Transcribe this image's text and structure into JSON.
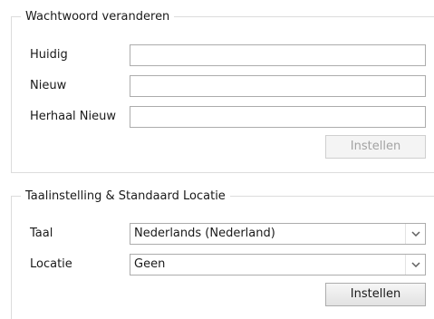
{
  "password_section": {
    "title": "Wachtwoord veranderen",
    "fields": [
      {
        "label": "Huidig",
        "value": ""
      },
      {
        "label": "Nieuw",
        "value": ""
      },
      {
        "label": "Herhaal Nieuw",
        "value": ""
      }
    ],
    "submit_label": "Instellen",
    "submit_enabled": false
  },
  "language_section": {
    "title": "Taalinstelling & Standaard Locatie",
    "language": {
      "label": "Taal",
      "selected": "Nederlands (Nederland)"
    },
    "location": {
      "label": "Locatie",
      "selected": "Geen"
    },
    "submit_label": "Instellen",
    "submit_enabled": true
  },
  "icons": {
    "dropdown": "chevron-down-icon"
  },
  "colors": {
    "border": "#acacac",
    "disabled_text": "#a3a3a3"
  }
}
